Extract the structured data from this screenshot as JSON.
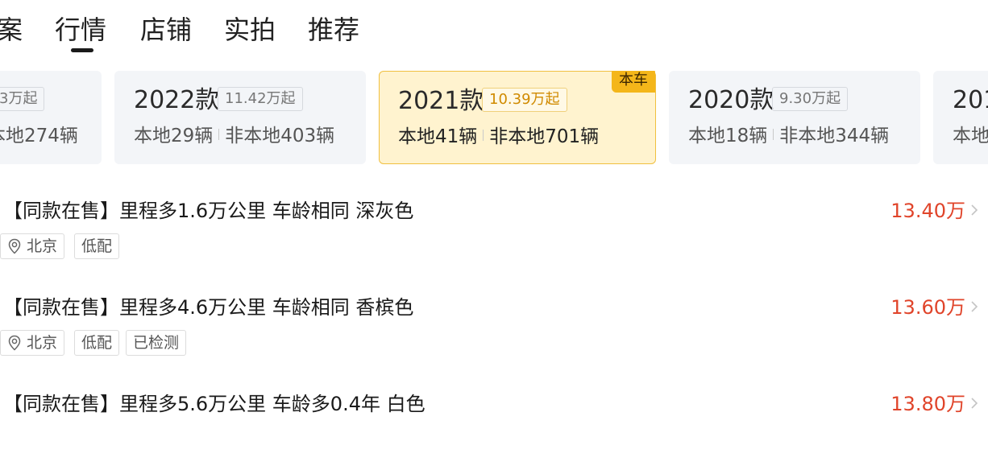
{
  "tabs": [
    {
      "label": "案",
      "active": false
    },
    {
      "label": "行情",
      "active": true
    },
    {
      "label": "店铺",
      "active": false
    },
    {
      "label": "实拍",
      "active": false
    },
    {
      "label": "推荐",
      "active": false
    }
  ],
  "year_cards": [
    {
      "year": "",
      "price": "3万起",
      "local": "本地274辆",
      "nonlocal": "",
      "selected": false
    },
    {
      "year": "2022款",
      "price": "11.42万起",
      "local": "本地29辆",
      "nonlocal": "非本地403辆",
      "selected": false
    },
    {
      "year": "2021款",
      "price": "10.39万起",
      "local": "本地41辆",
      "nonlocal": "非本地701辆",
      "selected": true,
      "badge": "本车"
    },
    {
      "year": "2020款",
      "price": "9.30万起",
      "local": "本地18辆",
      "nonlocal": "非本地344辆",
      "selected": false
    },
    {
      "year": "201",
      "price": "",
      "local": "本地",
      "nonlocal": "",
      "selected": false
    }
  ],
  "listings": [
    {
      "title": "【同款在售】里程多1.6万公里 车龄相同 深灰色",
      "price": "13.40万",
      "tags": [
        "北京",
        "低配"
      ]
    },
    {
      "title": "【同款在售】里程多4.6万公里 车龄相同 香槟色",
      "price": "13.60万",
      "tags": [
        "北京",
        "低配",
        "已检测"
      ]
    },
    {
      "title": "【同款在售】里程多5.6万公里 车龄多0.4年 白色",
      "price": "13.80万",
      "tags": []
    }
  ],
  "colors": {
    "accent_price": "#e0442a",
    "selected_bg": "#fff3cf",
    "badge_bg": "#f4b61a"
  }
}
